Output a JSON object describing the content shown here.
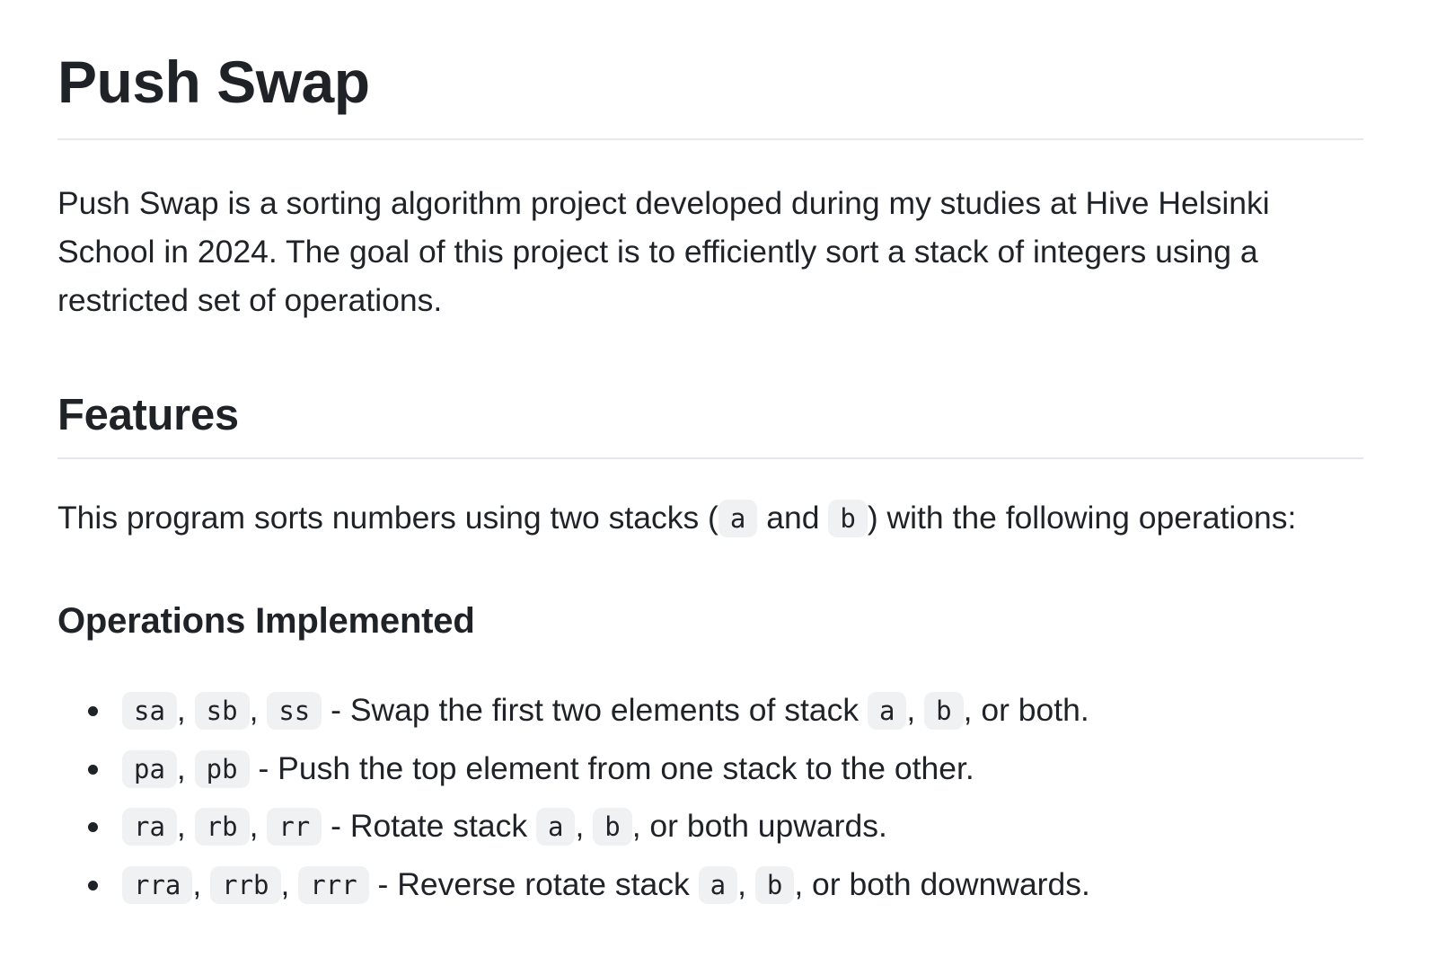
{
  "title": "Push Swap",
  "intro": "Push Swap is a sorting algorithm project developed during my studies at Hive Helsinki School in 2024. The goal of this project is to efficiently sort a stack of integers using a restricted set of operations.",
  "features": {
    "heading": "Features",
    "text_before": "This program sorts numbers using two stacks (",
    "stack_a": "a",
    "text_and": "and",
    "stack_b": "b",
    "text_after": ") with the following operations:"
  },
  "operations": {
    "heading": "Operations Implemented",
    "items": [
      {
        "codes": [
          "sa",
          "sb",
          "ss"
        ],
        "description": " - Swap the first two elements of stack ",
        "stack_a": "a",
        "stack_b": "b",
        "suffix": ", or both."
      },
      {
        "codes": [
          "pa",
          "pb"
        ],
        "description": " - Push the top element from one stack to the other."
      },
      {
        "codes": [
          "ra",
          "rb",
          "rr"
        ],
        "description": " - Rotate stack ",
        "stack_a": "a",
        "stack_b": "b",
        "suffix": ", or both upwards."
      },
      {
        "codes": [
          "rra",
          "rrb",
          "rrr"
        ],
        "description": " - Reverse rotate stack ",
        "stack_a": "a",
        "stack_b": "b",
        "suffix": ", or both downwards."
      }
    ]
  },
  "separators": {
    "comma": ","
  }
}
